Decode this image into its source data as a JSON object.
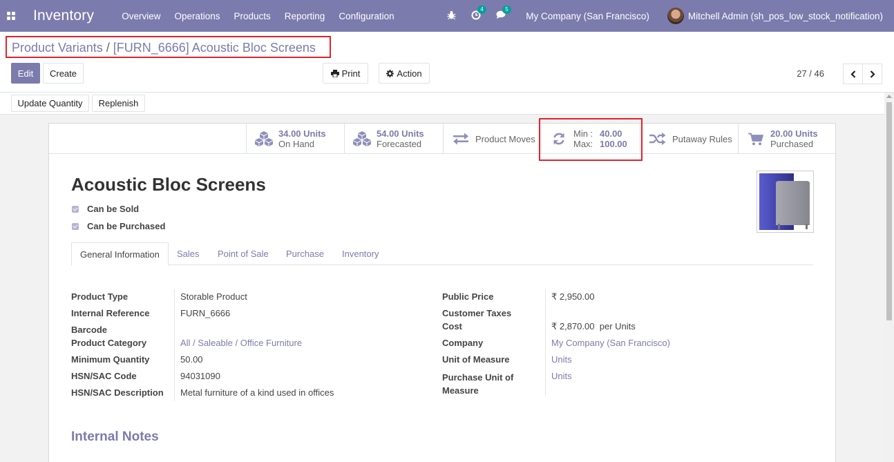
{
  "navbar": {
    "app_name": "Inventory",
    "menu": [
      "Overview",
      "Operations",
      "Products",
      "Reporting",
      "Configuration"
    ],
    "activity_count": "4",
    "messages_count": "5",
    "company": "My Company (San Francisco)",
    "user": "Mitchell Admin (sh_pos_low_stock_notification)",
    "icons": [
      "apps-icon",
      "bug-icon",
      "activity-clock-icon",
      "chat-icon"
    ]
  },
  "breadcrumb": {
    "parent": "Product Variants",
    "separator": "/",
    "current": "[FURN_6666] Acoustic Bloc Screens"
  },
  "toolbar": {
    "edit": "Edit",
    "create": "Create",
    "print": "Print",
    "action": "Action",
    "pager": "27 / 46"
  },
  "status_buttons": {
    "update_quantity": "Update Quantity",
    "replenish": "Replenish"
  },
  "smart_buttons": {
    "on_hand_value": "34.00 Units",
    "on_hand_label": "On Hand",
    "forecasted_value": "54.00 Units",
    "forecasted_label": "Forecasted",
    "moves_label": "Product Moves",
    "min_label": "Min :",
    "min_value": "40.00",
    "max_label": "Max:",
    "max_value": "100.00",
    "putaway_label": "Putaway Rules",
    "purchased_value": "20.00 Units",
    "purchased_label": "Purchased"
  },
  "product": {
    "name": "Acoustic Bloc Screens",
    "can_be_sold": "Can be Sold",
    "can_be_purchased": "Can be Purchased"
  },
  "tabs": [
    "General Information",
    "Sales",
    "Point of Sale",
    "Purchase",
    "Inventory"
  ],
  "left_fields": {
    "product_type_label": "Product Type",
    "product_type": "Storable Product",
    "internal_ref_label": "Internal Reference",
    "internal_ref": "FURN_6666",
    "barcode_label": "Barcode",
    "category_label": "Product Category",
    "category": "All / Saleable / Office Furniture",
    "min_qty_label": "Minimum Quantity",
    "min_qty": "50.00",
    "hsn_code_label": "HSN/SAC Code",
    "hsn_code": "94031090",
    "hsn_desc_label": "HSN/SAC Description",
    "hsn_desc": "Metal furniture of a kind used in offices"
  },
  "right_fields": {
    "public_price_label": "Public Price",
    "public_price": "₹ 2,950.00",
    "customer_taxes_label": "Customer Taxes",
    "cost_label": "Cost",
    "cost": "₹ 2,870.00",
    "cost_suffix": "per Units",
    "company_label": "Company",
    "company": "My Company (San Francisco)",
    "uom_label": "Unit of Measure",
    "uom": "Units",
    "purchase_uom_label_1": "Purchase Unit of",
    "purchase_uom_label_2": "Measure",
    "purchase_uom": "Units"
  },
  "notes_title": "Internal Notes"
}
